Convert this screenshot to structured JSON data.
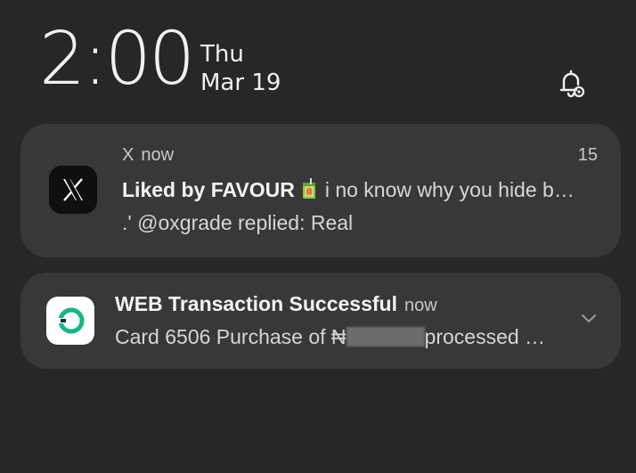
{
  "status": {
    "time": "2:00",
    "day": "Thu",
    "date": "Mar 19"
  },
  "notifications": [
    {
      "app": "X",
      "time": "now",
      "count": "15",
      "title_bold": "Liked by FAVOUR",
      "title_emoji": "juice-box-icon",
      "title_rest": "i no know why you hide b…",
      "body": ".' @oxgrade replied: Real",
      "icon": "x-logo-icon"
    },
    {
      "app": "bank",
      "title": "WEB Transaction Successful",
      "time": "now",
      "body_start": "Card 6506 Purchase of ₦",
      "body_end": "processed …",
      "icon": "bank-logo-icon",
      "accent": "#12b886"
    }
  ],
  "colors": {
    "background": "#272727",
    "card": "#383838"
  }
}
